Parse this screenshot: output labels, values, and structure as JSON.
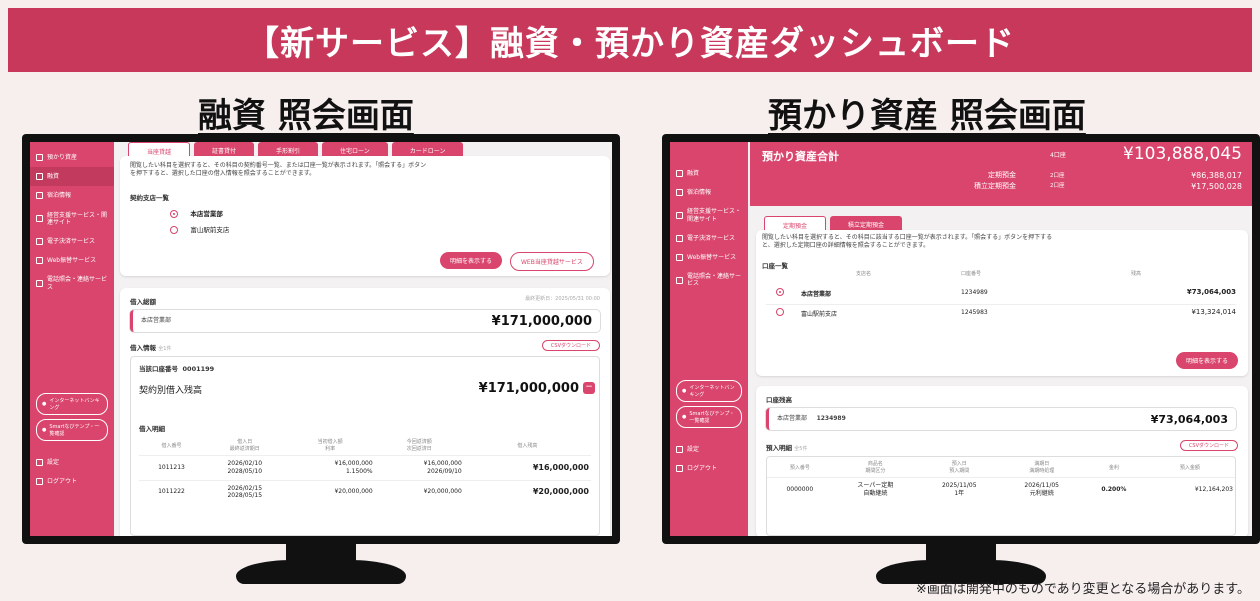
{
  "banner": {
    "title": "【新サービス】融資・預かり資産ダッシュボード"
  },
  "left": {
    "heading": "融資 照会画面",
    "sidebar": [
      {
        "label": "預かり資産"
      },
      {
        "label": "融資"
      },
      {
        "label": "宿泊情報"
      },
      {
        "label": "経営支援サービス・関連サイト"
      },
      {
        "label": "電子決済サービス"
      },
      {
        "label": "Web振替サービス"
      },
      {
        "label": "電話照会・連絡サービス"
      }
    ],
    "sidebar_buttons": [
      {
        "label": "インターネットバンキング"
      },
      {
        "label": "Smartなびテンプ・一覧確認"
      }
    ],
    "sidebar_bottom": [
      {
        "label": "設定"
      },
      {
        "label": "ログアウト"
      }
    ],
    "tabs": [
      "当座貸越",
      "証書貸付",
      "手形割引",
      "住宅ローン",
      "カードローン"
    ],
    "description": "閲覧したい科目を選択すると、その科目の契約番号一覧、または口座一覧が表示されます。「照会する」ボタンを押下すると、選択した口座の借入情報を照会することができます。",
    "branch_list_label": "契約支店一覧",
    "branches": [
      {
        "name": "本店営業部",
        "selected": true
      },
      {
        "name": "富山駅前支店",
        "selected": false
      }
    ],
    "btn_show": "明細を表示する",
    "btn_web": "WEB当座貸越サービス",
    "balance_title": "借入総額",
    "balance_updated": "最終更新日：2025/05/31 00:00",
    "balance_branch": "本店営業部",
    "balance_amount": "¥171,000,000",
    "loan_info_title": "借入情報",
    "loan_info_count": "全1件",
    "csv_btn": "CSVダウンロード",
    "account_label": "当該口座番号",
    "account_number": "0001199",
    "contract_label": "契約別借入残高",
    "contract_amount": "¥171,000,000",
    "detail_title": "借入明細",
    "table_headers": [
      "借入番号",
      "借入日\n最終返済期日",
      "当初借入額\n利率",
      "今回返済額\n次回返済日",
      "借入残高"
    ],
    "rows": [
      [
        "1011213",
        "2026/02/10\n2028/05/10",
        "¥16,000,000\n1.1500%",
        "¥16,000,000\n2026/09/10",
        "¥16,000,000"
      ],
      [
        "1011222",
        "2026/02/15\n2028/05/15",
        "¥20,000,000\n",
        "¥20,000,000\n",
        "¥20,000,000"
      ]
    ]
  },
  "right": {
    "heading": "預かり資産 照会画面",
    "sidebar": [
      {
        "label": "融資"
      },
      {
        "label": "宿泊情報"
      },
      {
        "label": "経営支援サービス・関連サイト"
      },
      {
        "label": "電子決済サービス"
      },
      {
        "label": "Web振替サービス"
      },
      {
        "label": "電話照会・連絡サービス"
      }
    ],
    "sidebar_buttons": [
      {
        "label": "インターネットバンキング"
      },
      {
        "label": "Smartなびテンプ・一覧確認"
      }
    ],
    "sidebar_bottom": [
      {
        "label": "設定"
      },
      {
        "label": "ログアウト"
      }
    ],
    "total_label": "預かり資産合計",
    "total_count": "4口座",
    "total_amount": "¥103,888,045",
    "sub_rows": [
      {
        "label": "定期預金",
        "count": "2口座",
        "amount": "¥86,388,017"
      },
      {
        "label": "積立定期預金",
        "count": "2口座",
        "amount": "¥17,500,028"
      }
    ],
    "tabs": [
      "定期預金",
      "積立定期預金"
    ],
    "description": "閲覧したい科目を選択すると、その科目に該当する口座一覧が表示されます。「照会する」ボタンを押下すると、選択した定期口座の詳細情報を照会することができます。",
    "list_label": "口座一覧",
    "list_headers": [
      "支店名",
      "口座番号",
      "残高"
    ],
    "accounts": [
      {
        "branch": "本店営業部",
        "number": "1234989",
        "amount": "¥73,064,003",
        "selected": true
      },
      {
        "branch": "富山駅前支店",
        "number": "1245983",
        "amount": "¥13,324,014",
        "selected": false
      }
    ],
    "btn_show": "明細を表示する",
    "balance_title": "口座残高",
    "balance_branch": "本店営業部",
    "balance_number": "1234989",
    "balance_amount": "¥73,064,003",
    "detail_title": "預入明細",
    "detail_count": "全5件",
    "csv_btn": "CSVダウンロード",
    "table_headers": [
      "預入番号",
      "商品名\n期間区分",
      "預入日\n預入期間",
      "満期日\n満期時処理",
      "金利",
      "預入金額"
    ],
    "rows": [
      [
        "0000000",
        "スーパー定期\n自動継続",
        "2025/11/05\n1年",
        "2026/11/05\n元利継続",
        "0.200%",
        "¥12,164,203"
      ]
    ]
  },
  "footnote": "※画面は開発中のものであり変更となる場合があります。"
}
